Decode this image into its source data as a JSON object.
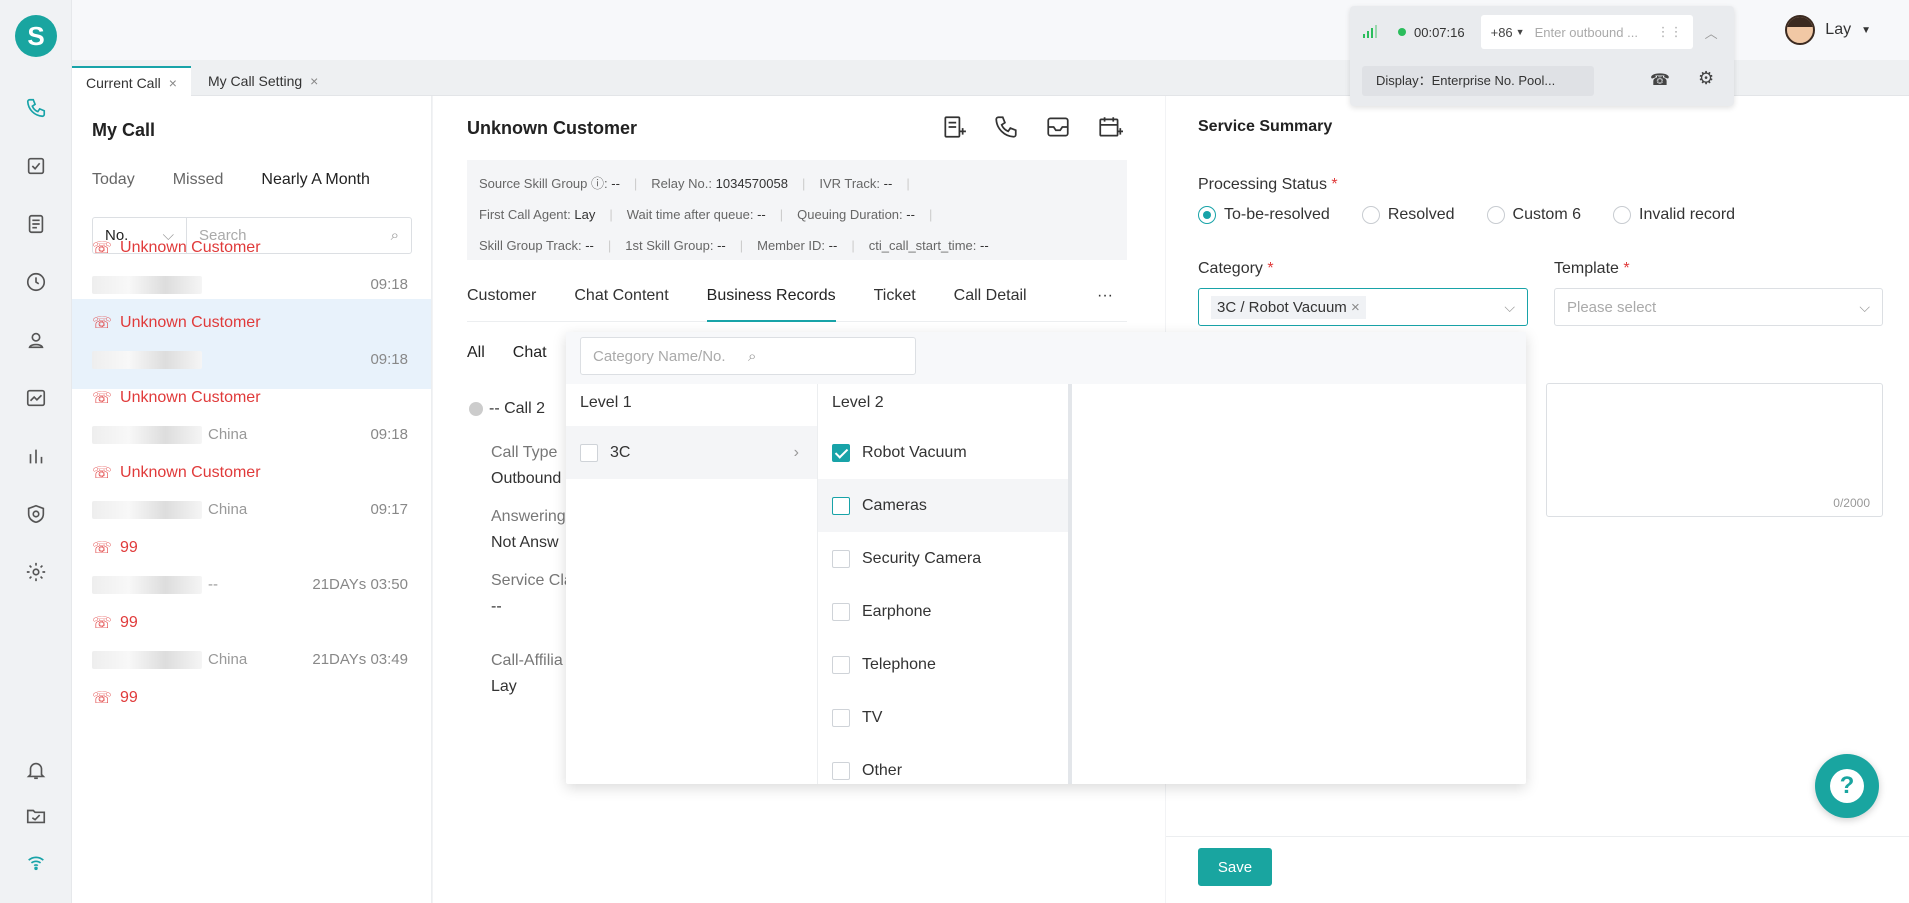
{
  "app": {
    "logo_letter": "S"
  },
  "rail": {
    "top_icons": [
      "phone-icon",
      "task-icon",
      "document-icon",
      "history-icon",
      "contact-icon",
      "monitor-icon",
      "report-icon",
      "shield-icon",
      "settings-icon"
    ],
    "bottom_icons": [
      "bell-icon",
      "folder-icon",
      "wifi-icon"
    ],
    "active": "phone-icon"
  },
  "tabs": [
    {
      "label": "Current Call",
      "close": "×"
    },
    {
      "label": "My Call Setting",
      "close": "×"
    }
  ],
  "phone_widget": {
    "timer": "00:07:16",
    "country_code": "+86",
    "placeholder": "Enter outbound ...",
    "display": "Display：Enterprise No. Pool..."
  },
  "user": {
    "name": "Lay"
  },
  "my_call": {
    "title": "My Call",
    "filters": [
      "Today",
      "Missed",
      "Nearly A Month"
    ],
    "search_type": "No.",
    "search_placeholder": "Search",
    "calls": [
      {
        "name": "Unknown Customer",
        "sub": "",
        "time": "09:18"
      },
      {
        "name": "Unknown Customer",
        "sub": "",
        "time": "09:18"
      },
      {
        "name": "Unknown Customer",
        "sub": "China",
        "time": "09:18"
      },
      {
        "name": "Unknown Customer",
        "sub": "China",
        "time": "09:17"
      },
      {
        "name": "99",
        "sub": "--",
        "time": "21DAYs 03:50"
      },
      {
        "name": "99",
        "sub": "China",
        "time": "21DAYs 03:49"
      },
      {
        "name": "99",
        "sub": "",
        "time": ""
      }
    ]
  },
  "customer": {
    "title": "Unknown Customer",
    "info": {
      "source_skill_group_label": "Source Skill Group ⓘ:",
      "source_skill_group": "--",
      "relay_label": "Relay No.:",
      "relay": "1034570058",
      "ivr_label": "IVR Track:",
      "ivr": "--",
      "first_agent_label": "First Call Agent:",
      "first_agent": "Lay",
      "wait_label": "Wait time after queue:",
      "wait": "--",
      "queue_label": "Queuing Duration:",
      "queue": "--",
      "skill_track_label": "Skill Group Track:",
      "skill_track": "--",
      "first_skill_label": "1st Skill Group:",
      "first_skill": "--",
      "member_label": "Member ID:",
      "member": "--",
      "cti_label": "cti_call_start_time:",
      "cti": "--"
    },
    "tabs": [
      "Customer",
      "Chat Content",
      "Business Records",
      "Ticket",
      "Call Detail"
    ],
    "more": "···",
    "subtabs": [
      "All",
      "Chat"
    ],
    "record": {
      "type": "-- Call",
      "num": "2"
    },
    "fields": [
      {
        "k": "Call Type",
        "v": "Outbound"
      },
      {
        "k": "Answering",
        "v": "Not Answ"
      },
      {
        "k": "Service Cla",
        "v": "--"
      },
      {
        "k": "Call-Affilia",
        "v": "Lay"
      }
    ]
  },
  "summary": {
    "title": "Service Summary",
    "status_label": "Processing Status",
    "statuses": [
      "To-be-resolved",
      "Resolved",
      "Custom 6",
      "Invalid record"
    ],
    "selected_status": "To-be-resolved",
    "category_label": "Category",
    "category_value": "3C / Robot Vacuum",
    "template_label": "Template",
    "template_placeholder": "Please select",
    "char_count": "0/2000",
    "save_label": "Save",
    "required_mark": "*"
  },
  "dropdown": {
    "search_placeholder": "Category Name/No.",
    "level1_label": "Level 1",
    "level2_label": "Level 2",
    "level1": [
      {
        "label": "3C",
        "checked": false
      }
    ],
    "level2": [
      {
        "label": "Robot Vacuum",
        "checked": true
      },
      {
        "label": "Cameras",
        "checked": false
      },
      {
        "label": "Security Camera",
        "checked": false
      },
      {
        "label": "Earphone",
        "checked": false
      },
      {
        "label": "Telephone",
        "checked": false
      },
      {
        "label": "TV",
        "checked": false
      },
      {
        "label": "Other",
        "checked": false
      }
    ]
  },
  "colors": {
    "accent": "#18a3a8",
    "danger": "#e03a3a"
  }
}
